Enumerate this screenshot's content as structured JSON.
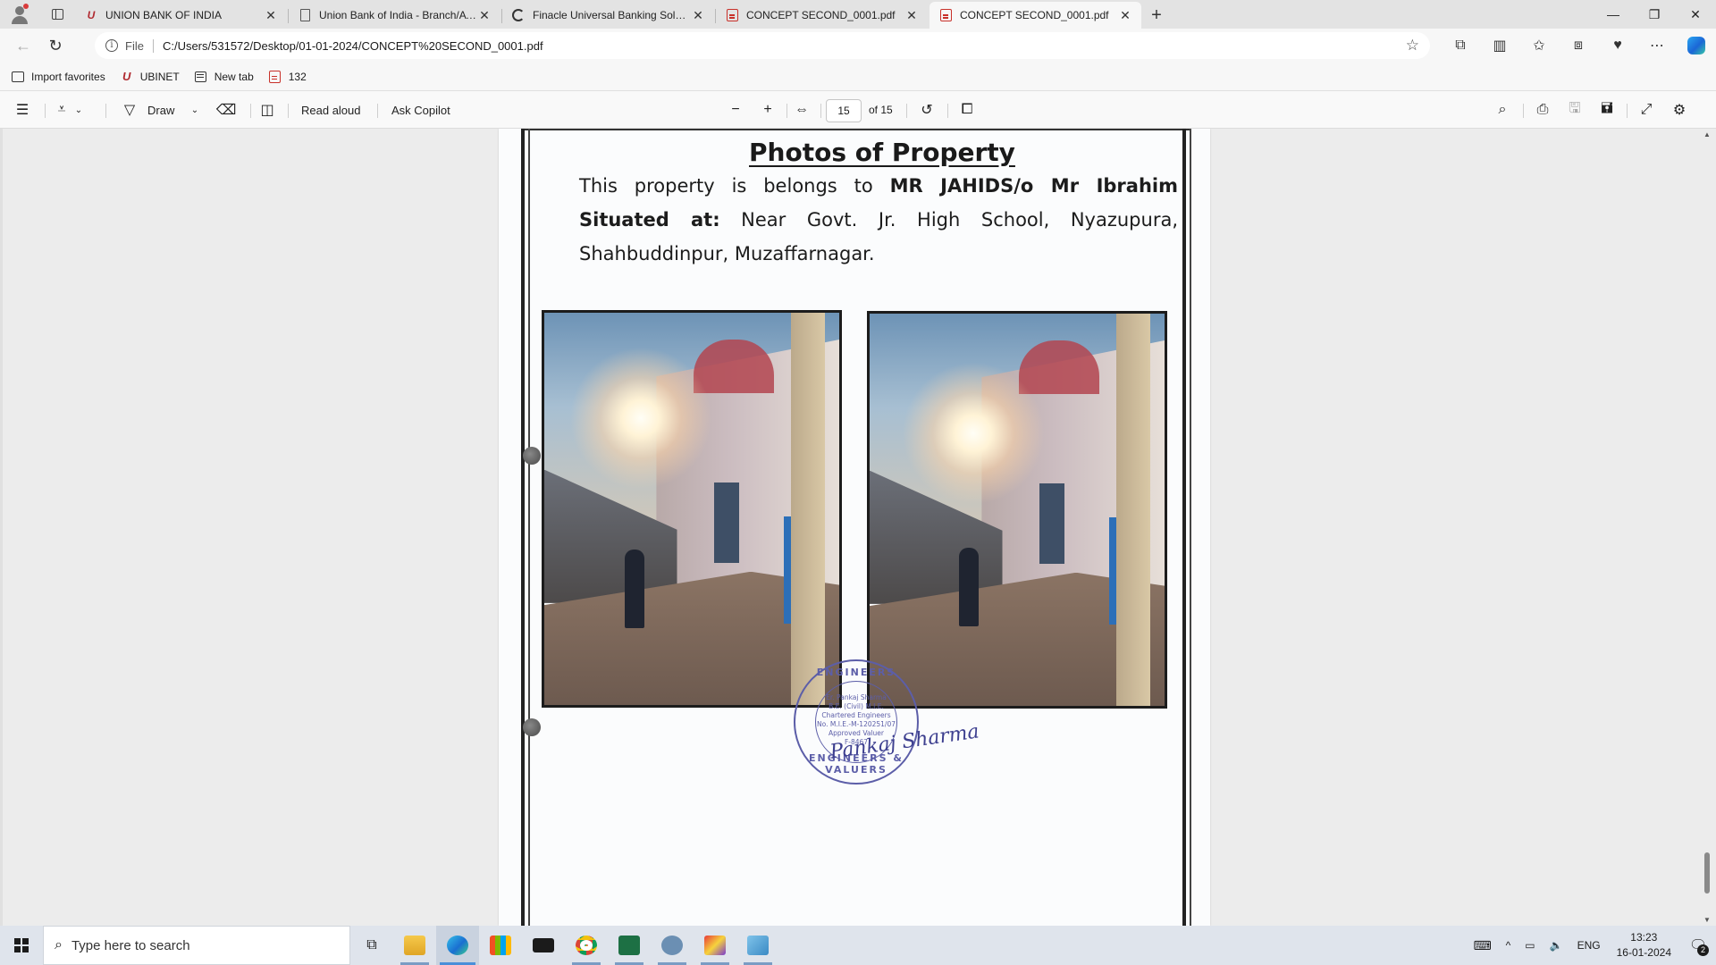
{
  "browser": {
    "tabs": [
      {
        "title": "UNION BANK OF INDIA",
        "icon": "ubi-logo-icon",
        "active": false
      },
      {
        "title": "Union Bank of India - Branch/ATM Locator",
        "icon": "page-icon",
        "active": false
      },
      {
        "title": "Finacle Universal Banking Solution",
        "icon": "edge-e-icon",
        "active": false
      },
      {
        "title": "CONCEPT SECOND_0001.pdf",
        "icon": "pdf-icon",
        "active": false
      },
      {
        "title": "CONCEPT SECOND_0001.pdf",
        "icon": "pdf-icon",
        "active": true
      }
    ],
    "address": {
      "scheme": "File",
      "url": "C:/Users/531572/Desktop/01-01-2024/CONCEPT%20SECOND_0001.pdf"
    },
    "favorites": [
      {
        "label": "Import favorites",
        "icon": "import-icon"
      },
      {
        "label": "UBINET",
        "icon": "ubi-logo-icon"
      },
      {
        "label": "New tab",
        "icon": "newtab-icon"
      },
      {
        "label": "132",
        "icon": "pdf-icon"
      }
    ]
  },
  "pdf_toolbar": {
    "draw_label": "Draw",
    "read_aloud_label": "Read aloud",
    "ask_copilot_label": "Ask Copilot",
    "current_page": "15",
    "page_total": "of 15"
  },
  "document": {
    "title": "Photos of Property",
    "line1_prefix": "This property is belongs to ",
    "owner": "MR JAHIDS/o Mr Ibrahim",
    "situated_label": "Situated at:",
    "address": " Near Govt. Jr. High School, Nyazupura, Shahbuddinpur, Muzaffarnagar.",
    "stamp": {
      "ring_top": "ENGINEERS",
      "ring_bottom": "ENGINEERS & VALUERS",
      "line1": "Er. Pankaj Sharma",
      "line2": "B.E. (Civil) M.I.E.",
      "line3": "Chartered Engineers",
      "line4": "No. M.I.E.-M-120251/07",
      "line5": "Approved Valuer",
      "line6": "F-8467",
      "signature": "Pankaj Sharma"
    }
  },
  "taskbar": {
    "search_placeholder": "Type here to search",
    "language": "ENG",
    "time": "13:23",
    "date": "16-01-2024",
    "notifications": "2"
  }
}
